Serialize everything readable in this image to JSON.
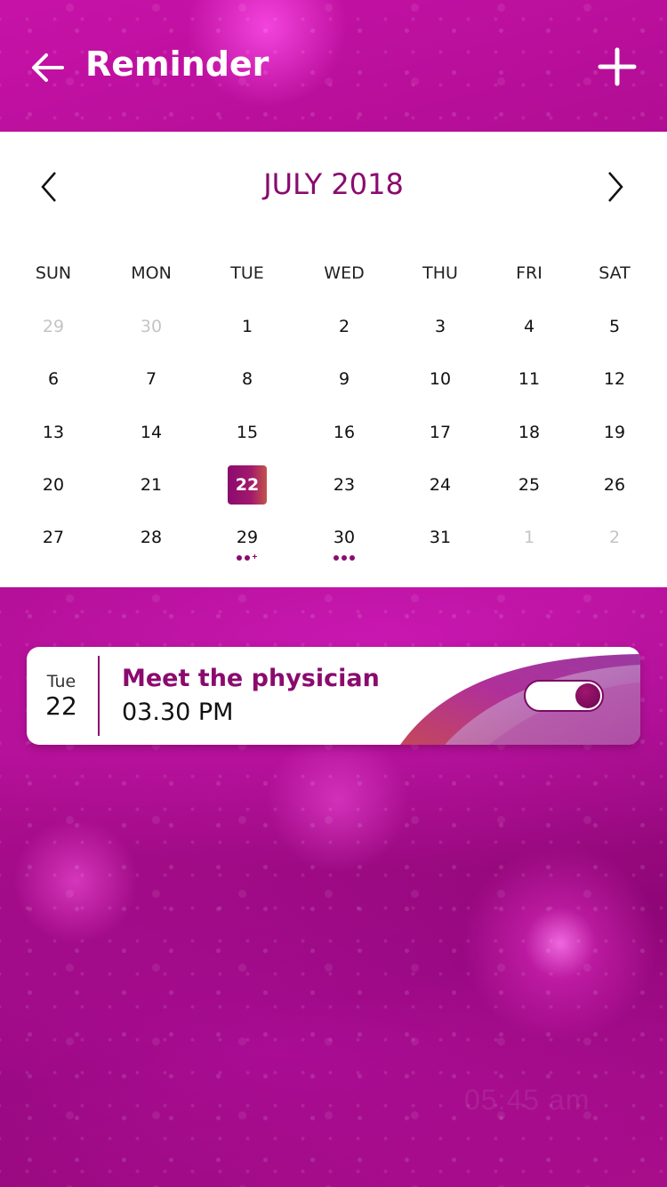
{
  "header": {
    "title": "Reminder",
    "back_icon": "arrow-left-icon",
    "add_icon": "plus-icon"
  },
  "calendar": {
    "month_label": "JULY 2018",
    "prev_icon": "chevron-left-icon",
    "next_icon": "chevron-right-icon",
    "weekdays": [
      "SUN",
      "MON",
      "TUE",
      "WED",
      "THU",
      "FRI",
      "SAT"
    ],
    "weeks": [
      [
        "29",
        "30",
        "1",
        "2",
        "3",
        "4",
        "5"
      ],
      [
        "6",
        "7",
        "8",
        "9",
        "10",
        "11",
        "12"
      ],
      [
        "13",
        "14",
        "15",
        "16",
        "17",
        "18",
        "19"
      ],
      [
        "20",
        "21",
        "22",
        "23",
        "24",
        "25",
        "26"
      ],
      [
        "27",
        "28",
        "29",
        "30",
        "31",
        "1",
        "2"
      ]
    ],
    "outside_month": [
      [
        0,
        0
      ],
      [
        0,
        1
      ],
      [
        4,
        5
      ],
      [
        4,
        6
      ]
    ],
    "selected": [
      3,
      2
    ],
    "event_markers": [
      {
        "cell": [
          4,
          2
        ],
        "dots": 2,
        "more": true
      },
      {
        "cell": [
          4,
          3
        ],
        "dots": 3,
        "more": false
      }
    ]
  },
  "reminder": {
    "day_of_week": "Tue",
    "day": "22",
    "title": "Meet the physician",
    "time": "03.30 PM",
    "enabled": true
  },
  "background_time": "05:45 am",
  "colors": {
    "accent": "#8a0b6e",
    "background": "#a1087e",
    "muted_day": "#c4c4c4"
  }
}
